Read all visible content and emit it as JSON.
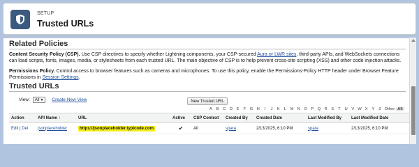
{
  "header": {
    "breadcrumb": "SETUP",
    "title": "Trusted URLs",
    "icon": "shield-icon"
  },
  "related_policies": {
    "title": "Related Policies",
    "csp": {
      "heading": "Content Security Policy (CSP).",
      "text_1": " Use CSP directives to specify whether Lightning components, your CSP-secured ",
      "link_1": "Aura or LWR sites",
      "text_2": ", third-party APIs, and WebSockets connections can load scripts, fonts, images, media, or stylesheets from each trusted URL. The main objective of CSP is to help prevent cross-site scripting (XSS) and other code injection attacks."
    },
    "permissions": {
      "heading": "Permissions Policy.",
      "text_1": " Control access to browser features such as cameras and microphones. To use this policy, enable the Permissions-Policy HTTP header under Browser Feature Permissions in ",
      "link_1": "Session Settings",
      "text_2": "."
    }
  },
  "trusted_urls": {
    "title": "Trusted URLs",
    "view_label": "View:",
    "view_value": "All",
    "create_new_view": "Create New View",
    "new_button": "New Trusted URL",
    "alpha": [
      "A",
      "B",
      "C",
      "D",
      "E",
      "F",
      "G",
      "H",
      "I",
      "J",
      "K",
      "L",
      "M",
      "N",
      "O",
      "P",
      "Q",
      "R",
      "S",
      "T",
      "U",
      "V",
      "W",
      "X",
      "Y",
      "Z"
    ],
    "alpha_other": "Other",
    "alpha_all": "All",
    "columns": {
      "action": "Action",
      "api_name": "API Name",
      "sort_indicator": "↑",
      "url": "URL",
      "active": "Active",
      "csp_context": "CSP Context",
      "created_by": "Created By",
      "created_date": "Created Date",
      "last_modified_by": "Last Modified By",
      "last_modified_date": "Last Modified Date"
    },
    "rows": [
      {
        "edit": "Edit",
        "sep": "|",
        "del": "Del",
        "api_name": "jsonplaceholder",
        "url": "https://jsonplaceholder.typicode.com",
        "active": "✔",
        "csp_context": "All",
        "created_by": "spara",
        "created_date": "2/13/2025, 6:10 PM",
        "last_modified_by": "spara",
        "last_modified_date": "2/13/2025, 6:10 PM"
      }
    ]
  }
}
